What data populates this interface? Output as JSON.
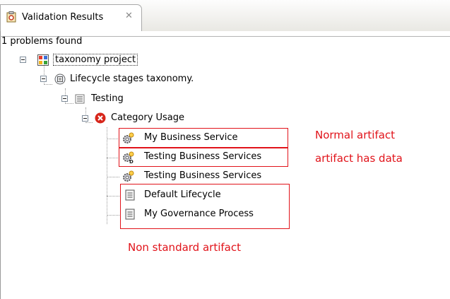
{
  "tab": {
    "title": "Validation Results"
  },
  "status": {
    "text": "1 problems found"
  },
  "tree": {
    "root": "taxonomy project",
    "taxonomy": "Lifecycle stages taxonomy.",
    "stage": "Testing",
    "problem": "Category Usage",
    "items": [
      "My Business Service",
      "Testing Business Services",
      "Testing Business Services",
      "Default Lifecycle",
      "My Governance Process"
    ]
  },
  "annotations": {
    "normal": "Normal artifact",
    "data": "artifact has data",
    "nonstandard": "Non standard artifact"
  },
  "colors": {
    "annotation": "#e1131a"
  }
}
